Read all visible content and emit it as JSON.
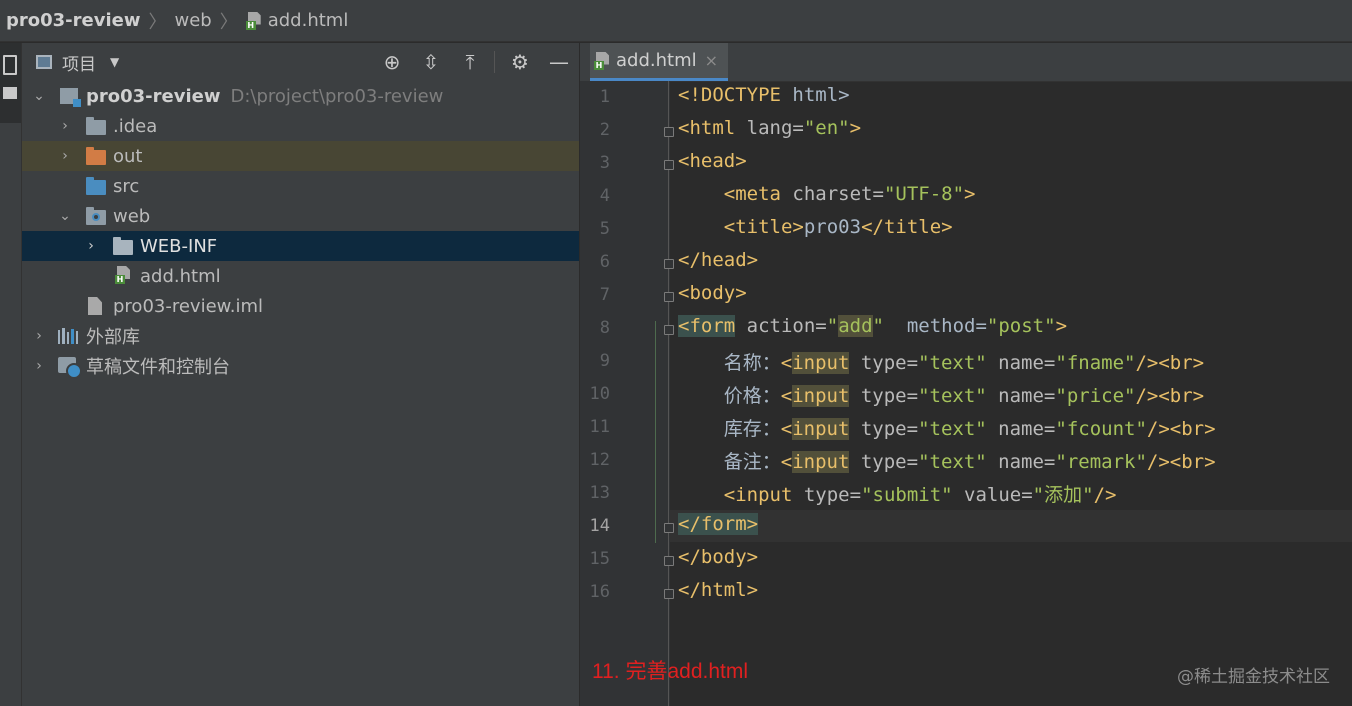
{
  "breadcrumb": {
    "project": "pro03-review",
    "folder": "web",
    "file": "add.html"
  },
  "panel": {
    "title": "项目",
    "dropdown_icon": "caret-down-icon",
    "buttons": [
      "locate-icon",
      "expand-all-icon",
      "collapse-all-icon",
      "gear-icon",
      "minimize-icon"
    ]
  },
  "tree": {
    "root_name": "pro03-review",
    "root_path": "D:\\project\\pro03-review",
    "idea": ".idea",
    "out": "out",
    "src": "src",
    "web": "web",
    "webinf": "WEB-INF",
    "addhtml": "add.html",
    "iml": "pro03-review.iml",
    "external_libs": "外部库",
    "scratches": "草稿文件和控制台"
  },
  "editor": {
    "tab_label": "add.html",
    "tab_close": "×",
    "current_line": 14,
    "line_numbers": [
      "1",
      "2",
      "3",
      "4",
      "5",
      "6",
      "7",
      "8",
      "9",
      "10",
      "11",
      "12",
      "13",
      "14",
      "15",
      "16"
    ],
    "lines": [
      "<!DOCTYPE html>",
      "<html lang=\"en\">",
      "<head>",
      "    <meta charset=\"UTF-8\">",
      "    <title>pro03</title>",
      "</head>",
      "<body>",
      "<form action=\"add\"  method=\"post\">",
      "    名称：<input type=\"text\" name=\"fname\"/><br>",
      "    价格：<input type=\"text\" name=\"price\"/><br>",
      "    库存：<input type=\"text\" name=\"fcount\"/><br>",
      "    备注：<input type=\"text\" name=\"remark\"/><br>",
      "    <input type=\"submit\" value=\"添加\"/>",
      "</form>",
      "</body>",
      "</html>"
    ]
  },
  "annotation": {
    "note": "11. 完善add.html",
    "note_color": "#e02020",
    "watermark": "@稀土掘金技术社区"
  },
  "colors": {
    "tag": "#e8bf6a",
    "attribute": "#bababa",
    "string": "#a5c25c",
    "selection": "#0d293e",
    "highlight_row": "#484634"
  }
}
